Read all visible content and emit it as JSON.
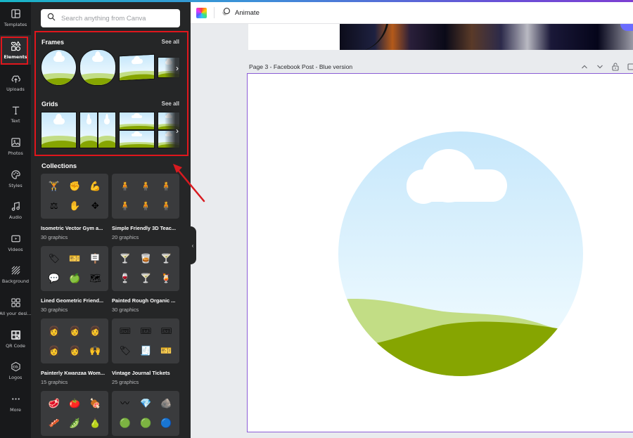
{
  "rail": {
    "items": [
      {
        "label": "Templates",
        "icon": "templates-icon",
        "active": false
      },
      {
        "label": "Elements",
        "icon": "elements-icon",
        "active": true
      },
      {
        "label": "Uploads",
        "icon": "upload-cloud-icon",
        "active": false
      },
      {
        "label": "Text",
        "icon": "text-icon",
        "active": false
      },
      {
        "label": "Photos",
        "icon": "photos-icon",
        "active": false
      },
      {
        "label": "Styles",
        "icon": "palette-icon",
        "active": false
      },
      {
        "label": "Audio",
        "icon": "music-note-icon",
        "active": false
      },
      {
        "label": "Videos",
        "icon": "video-icon",
        "active": false
      },
      {
        "label": "Background",
        "icon": "background-icon",
        "active": false
      },
      {
        "label": "All your desi...",
        "icon": "grid-icon",
        "active": false
      },
      {
        "label": "QR Code",
        "icon": "qr-code-icon",
        "active": false
      },
      {
        "label": "Logos",
        "icon": "logo-icon",
        "active": false
      },
      {
        "label": "More",
        "icon": "more-dots-icon",
        "active": false
      }
    ]
  },
  "panel": {
    "search_placeholder": "Search anything from Canva",
    "frames": {
      "title": "Frames",
      "see_all": "See all"
    },
    "grids": {
      "title": "Grids",
      "see_all": "See all"
    },
    "collections_title": "Collections",
    "collections": [
      {
        "name": "Isometric Vector Gym a...",
        "count": "30 graphics",
        "glyphs": [
          "🏋",
          "✊",
          "💪",
          "⚖",
          "✋",
          "✥"
        ]
      },
      {
        "name": "Simple Friendly 3D Teac...",
        "count": "20 graphics",
        "glyphs": [
          "🧍",
          "🧍",
          "🧍",
          "🧍",
          "🧍",
          "🧍"
        ]
      },
      {
        "name": "Lined Geometric Friend...",
        "count": "30 graphics",
        "glyphs": [
          "🏷",
          "🎫",
          "🪧",
          "💬",
          "🍏",
          "🗺"
        ]
      },
      {
        "name": "Painted Rough Organic ...",
        "count": "30 graphics",
        "glyphs": [
          "🍸",
          "🥃",
          "🍸",
          "🍷",
          "🍸",
          "🍹"
        ]
      },
      {
        "name": "Painterly Kwanzaa Wom...",
        "count": "15 graphics",
        "glyphs": [
          "👩",
          "👩",
          "👩",
          "👩",
          "👩",
          "🙌"
        ]
      },
      {
        "name": "Vintage Journal Tickets",
        "count": "25 graphics",
        "glyphs": [
          "🎟",
          "🎟",
          "🎟",
          "🏷",
          "🧾",
          "🎫"
        ]
      },
      {
        "name": "",
        "count": "",
        "glyphs": [
          "🥩",
          "🍅",
          "🍖",
          "🥓",
          "🫛",
          "🍐"
        ]
      },
      {
        "name": "",
        "count": "",
        "glyphs": [
          "〰",
          "💎",
          "🪨",
          "🟢",
          "🟢",
          "🔵"
        ]
      }
    ]
  },
  "toolbar": {
    "animate_label": "Animate"
  },
  "canvas": {
    "page_label": "Page 3 - Facebook Post - Blue version",
    "controls": {
      "up": "⌃",
      "down": "⌄",
      "lock": "🔓"
    }
  },
  "colors": {
    "accent_purple": "#8b5cd6",
    "highlight_red": "#e0161c",
    "panel_bg": "#252627",
    "rail_bg": "#18191b",
    "hill_light": "#c2dd85",
    "hill_dark": "#86a501",
    "sky_top": "#c6e7fb"
  }
}
